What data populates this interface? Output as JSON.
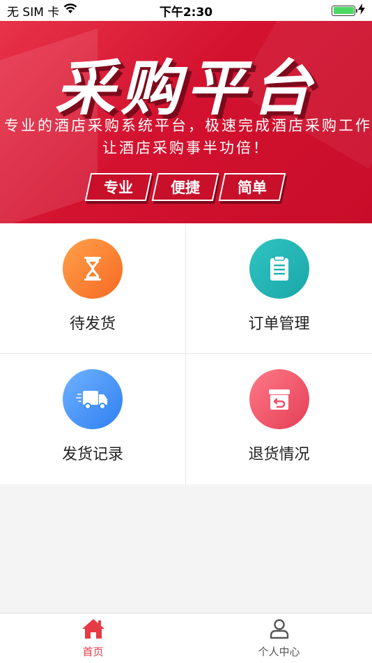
{
  "status_bar": {
    "carrier": "无 SIM 卡",
    "time": "下午2:30"
  },
  "banner": {
    "title": "采购平台",
    "subtitle_line1": "专业的酒店采购系统平台，极速完成酒店采购工作",
    "subtitle_line2": "让酒店采购事半功倍！",
    "tags": [
      "专业",
      "便捷",
      "简单"
    ]
  },
  "menu": {
    "items": [
      {
        "label": "待发货",
        "icon": "hourglass-icon",
        "color": "#f7862f"
      },
      {
        "label": "订单管理",
        "icon": "clipboard-icon",
        "color": "#22b5b2"
      },
      {
        "label": "发货记录",
        "icon": "delivery-truck-icon",
        "color": "#3d8cf6"
      },
      {
        "label": "退货情况",
        "icon": "return-box-icon",
        "color": "#ea4f63"
      }
    ]
  },
  "tabbar": {
    "items": [
      {
        "label": "首页",
        "icon": "home-icon",
        "active": true
      },
      {
        "label": "个人中心",
        "icon": "user-icon",
        "active": false
      }
    ],
    "active_color": "#e63a44"
  }
}
